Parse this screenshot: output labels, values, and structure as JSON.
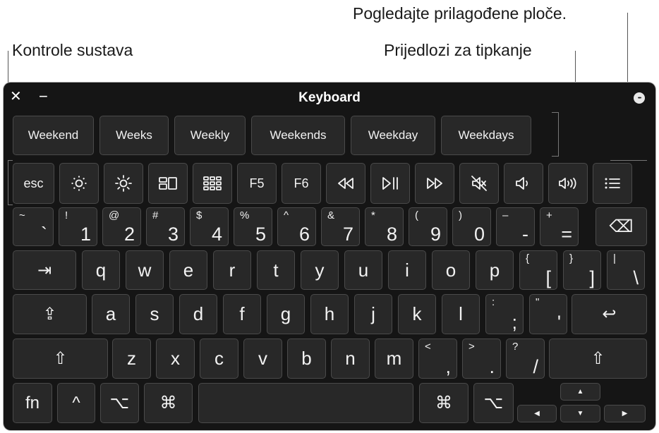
{
  "callouts": {
    "custom_panels": "Pogledajte prilagođene ploče.",
    "system_controls": "Kontrole sustava",
    "typing_suggestions": "Prijedlozi za tipkanje"
  },
  "window": {
    "title": "Keyboard",
    "close_glyph": "✕",
    "minimize_glyph": "−",
    "menu_glyph": "•••"
  },
  "suggestions": [
    "Weekend",
    "Weeks",
    "Weekly",
    "Weekends",
    "Weekday",
    "Weekdays"
  ],
  "system_row": [
    {
      "label": "esc",
      "icon": "escape"
    },
    {
      "label": "",
      "icon": "brightness-down-icon"
    },
    {
      "label": "",
      "icon": "brightness-up-icon"
    },
    {
      "label": "",
      "icon": "mission-control-icon"
    },
    {
      "label": "",
      "icon": "launchpad-icon"
    },
    {
      "label": "F5",
      "icon": "f5"
    },
    {
      "label": "F6",
      "icon": "f6"
    },
    {
      "label": "",
      "icon": "rewind-icon"
    },
    {
      "label": "",
      "icon": "play-pause-icon"
    },
    {
      "label": "",
      "icon": "fast-forward-icon"
    },
    {
      "label": "",
      "icon": "mute-icon"
    },
    {
      "label": "",
      "icon": "volume-down-icon"
    },
    {
      "label": "",
      "icon": "volume-up-icon"
    },
    {
      "label": "",
      "icon": "panels-list-icon"
    }
  ],
  "number_row": [
    {
      "sec": "~",
      "prim": "`"
    },
    {
      "sec": "!",
      "prim": "1"
    },
    {
      "sec": "@",
      "prim": "2"
    },
    {
      "sec": "#",
      "prim": "3"
    },
    {
      "sec": "$",
      "prim": "4"
    },
    {
      "sec": "%",
      "prim": "5"
    },
    {
      "sec": "^",
      "prim": "6"
    },
    {
      "sec": "&",
      "prim": "7"
    },
    {
      "sec": "*",
      "prim": "8"
    },
    {
      "sec": "(",
      "prim": "9"
    },
    {
      "sec": ")",
      "prim": "0"
    },
    {
      "sec": "–",
      "prim": "-"
    },
    {
      "sec": "+",
      "prim": "="
    }
  ],
  "backspace_glyph": "⌫",
  "row_q": {
    "tab_glyph": "⇥",
    "letters": [
      "q",
      "w",
      "e",
      "r",
      "t",
      "y",
      "u",
      "i",
      "o",
      "p"
    ],
    "symbols": [
      {
        "sec": "{",
        "prim": "["
      },
      {
        "sec": "}",
        "prim": "]"
      },
      {
        "sec": "|",
        "prim": "\\"
      }
    ]
  },
  "row_a": {
    "caps_glyph": "⇪",
    "letters": [
      "a",
      "s",
      "d",
      "f",
      "g",
      "h",
      "j",
      "k",
      "l"
    ],
    "symbols": [
      {
        "sec": ":",
        "prim": ";"
      },
      {
        "sec": "\"",
        "prim": "'"
      }
    ],
    "return_glyph": "↩"
  },
  "row_z": {
    "shift_glyph": "⇧",
    "letters": [
      "z",
      "x",
      "c",
      "v",
      "b",
      "n",
      "m"
    ],
    "symbols": [
      {
        "sec": "<",
        "prim": ","
      },
      {
        "sec": ">",
        "prim": "."
      },
      {
        "sec": "?",
        "prim": "/"
      }
    ]
  },
  "bottom_row": {
    "fn": "fn",
    "control": "^",
    "option": "⌥",
    "command": "⌘",
    "arrow_up": "▲",
    "arrow_left": "◀",
    "arrow_down": "▼",
    "arrow_right": "▶"
  }
}
